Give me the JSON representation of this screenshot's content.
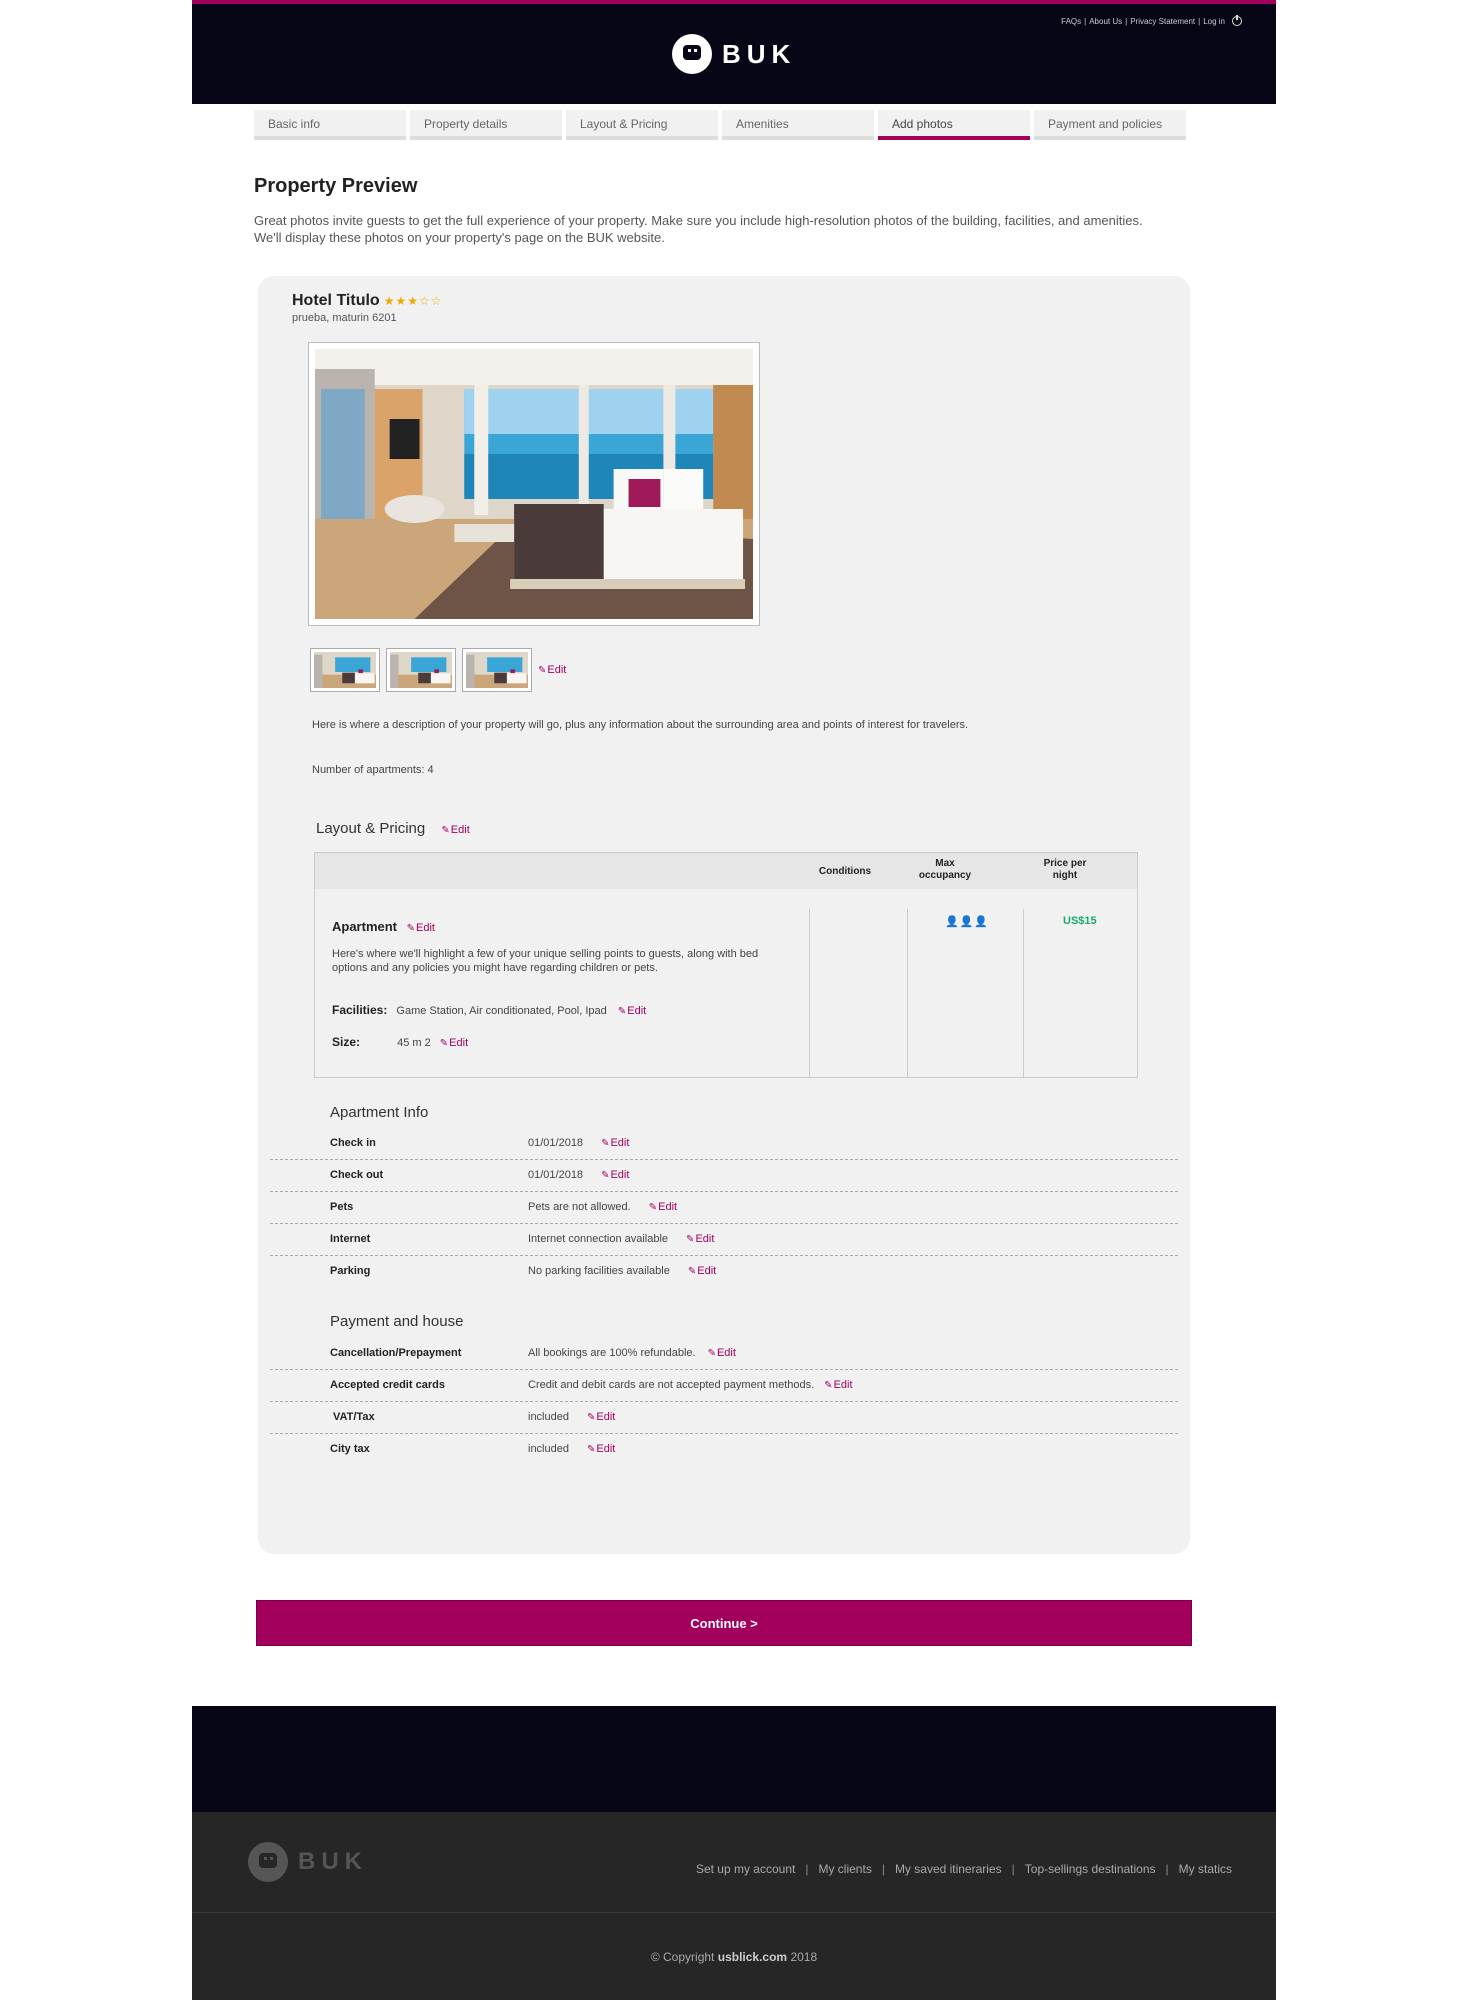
{
  "header": {
    "links": [
      "FAQs",
      "About Us",
      "Privacy Statement",
      "Log in"
    ],
    "logo_text": "BUK"
  },
  "tabs": [
    {
      "label": "Basic info"
    },
    {
      "label": "Property details"
    },
    {
      "label": "Layout & Pricing"
    },
    {
      "label": "Amenities"
    },
    {
      "label": "Add photos",
      "active": true
    },
    {
      "label": "Payment and policies"
    }
  ],
  "page": {
    "title": "Property Preview",
    "intro": "Great photos invite guests to get the full experience of your property. Make sure you include high-resolution photos of the building, facilities, and amenities. We'll display these photos on your property's page on the BUK website."
  },
  "property": {
    "name": "Hotel Titulo",
    "stars": "★★★☆☆",
    "rating": 3,
    "address": "prueba, maturin 6201",
    "edit_label": "Edit",
    "description": "Here is where a description of your property will go, plus any information about the surrounding area and points of interest for travelers.",
    "apartments": "Number of apartments: 4"
  },
  "layout_pricing": {
    "title": "Layout & Pricing",
    "edit_label": "Edit",
    "columns": {
      "conditions": "Conditions",
      "max_occupancy": "Max occupancy",
      "price": "Price per night"
    },
    "apartment": {
      "name": "Apartment",
      "edit_label": "Edit",
      "description": "Here's where we'll highlight a few of your unique selling points to guests, along with bed options and any policies you might have regarding children or pets.",
      "facilities_label": "Facilities:",
      "facilities": "Game Station, Air conditionated, Pool, Ipad",
      "size_label": "Size:",
      "size": "45 m 2",
      "occupancy_icons": "👤👤👤",
      "price": "US$15"
    }
  },
  "apartment_info": {
    "title": "Apartment Info",
    "rows": [
      {
        "label": "Check in",
        "value": "01/01/2018",
        "edit": "Edit"
      },
      {
        "label": "Check out",
        "value": "01/01/2018",
        "edit": "Edit"
      },
      {
        "label": "Pets",
        "value": "Pets are not allowed.",
        "edit": "Edit"
      },
      {
        "label": "Internet",
        "value": "Internet connection available",
        "edit": "Edit"
      },
      {
        "label": "Parking",
        "value": "No parking facilities available",
        "edit": "Edit"
      }
    ]
  },
  "payment": {
    "title": "Payment and house",
    "rows": [
      {
        "label": "Cancellation/Prepayment",
        "value": "All bookings are 100% refundable.",
        "edit": "Edit"
      },
      {
        "label": "Accepted credit cards",
        "value": "Credit and debit cards are not accepted payment methods.",
        "edit": "Edit"
      },
      {
        "label": " VAT/Tax",
        "value": "included",
        "edit": "Edit"
      },
      {
        "label": "City tax",
        "value": "included",
        "edit": "Edit"
      }
    ]
  },
  "continue_label": "Continue >",
  "footer": {
    "logo_text": "BUK",
    "links": [
      "Set up my account",
      "My clients",
      "My saved itineraries",
      "Top-sellings destinations",
      "My statics"
    ],
    "copyright_prefix": "© Copyright",
    "copyright_site": "usblick.com",
    "copyright_year": "2018"
  },
  "colors": {
    "brand": "#a3005e",
    "dark": "#060616",
    "price": "#1aaa6a",
    "stars": "#f0a800"
  }
}
